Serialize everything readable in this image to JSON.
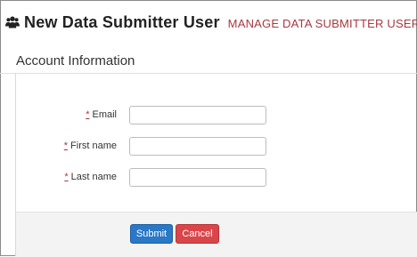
{
  "header": {
    "icon": "users-icon",
    "title": "New Data Submitter User",
    "manage_link": "MANAGE DATA SUBMITTER USERS"
  },
  "section": {
    "title": "Account Information"
  },
  "form": {
    "required_marker": "*",
    "fields": [
      {
        "label": "Email",
        "value": "",
        "placeholder": ""
      },
      {
        "label": "First name",
        "value": "",
        "placeholder": ""
      },
      {
        "label": "Last name",
        "value": "",
        "placeholder": ""
      }
    ]
  },
  "actions": {
    "submit_label": "Submit",
    "cancel_label": "Cancel"
  },
  "colors": {
    "accent_link": "#a7393f",
    "submit": "#2a78c6",
    "cancel": "#d9464a"
  }
}
